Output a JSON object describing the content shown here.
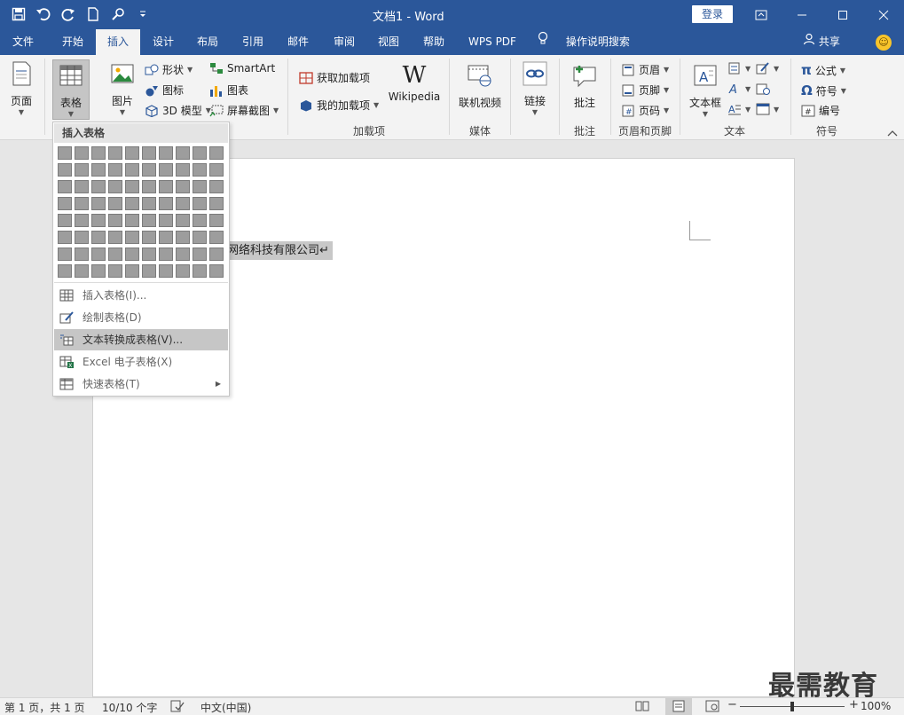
{
  "title": "文档1  -  Word",
  "login_label": "登录",
  "tabs": [
    "文件",
    "开始",
    "插入",
    "设计",
    "布局",
    "引用",
    "邮件",
    "审阅",
    "视图",
    "帮助",
    "WPS PDF",
    "操作说明搜索"
  ],
  "active_tab": "插入",
  "share_label": "共享",
  "ribbon": {
    "page_label": "页面",
    "table_label": "表格",
    "picture_label": "图片",
    "shapes_label": "形状",
    "icons_label": "图标",
    "model3d_label": "3D 模型",
    "smartart_label": "SmartArt",
    "chart_label": "图表",
    "screenshot_label": "屏幕截图",
    "get_addins_label": "获取加载项",
    "my_addins_label": "我的加载项",
    "wikipedia_label": "Wikipedia",
    "addins_group": "加载项",
    "online_video_label": "联机视频",
    "media_group": "媒体",
    "link_label": "链接",
    "comment_label": "批注",
    "comment_group": "批注",
    "header_label": "页眉",
    "footer_label": "页脚",
    "pagenum_label": "页码",
    "headerfooter_group": "页眉和页脚",
    "textbox_label": "文本框",
    "text_group": "文本",
    "equation_label": "公式",
    "symbol_label": "符号",
    "number_label": "编号",
    "symbols_group": "符号"
  },
  "dropdown": {
    "header": "插入表格",
    "items": [
      "插入表格(I)...",
      "绘制表格(D)",
      "文本转换成表格(V)...",
      "Excel 电子表格(X)",
      "快速表格(T)"
    ],
    "highlighted_index": 2
  },
  "document": {
    "selected_text": "网络科技有限公司↵"
  },
  "status": {
    "page": "第 1 页，共 1 页",
    "words": "10/10 个字",
    "language": "中文(中国)",
    "zoom": "100%",
    "zoom_level": 100
  },
  "watermark": "最需教育",
  "colors": {
    "accent": "#2b579a",
    "ribbon_bg": "#f3f3f3",
    "highlight": "#c6c6c6"
  }
}
